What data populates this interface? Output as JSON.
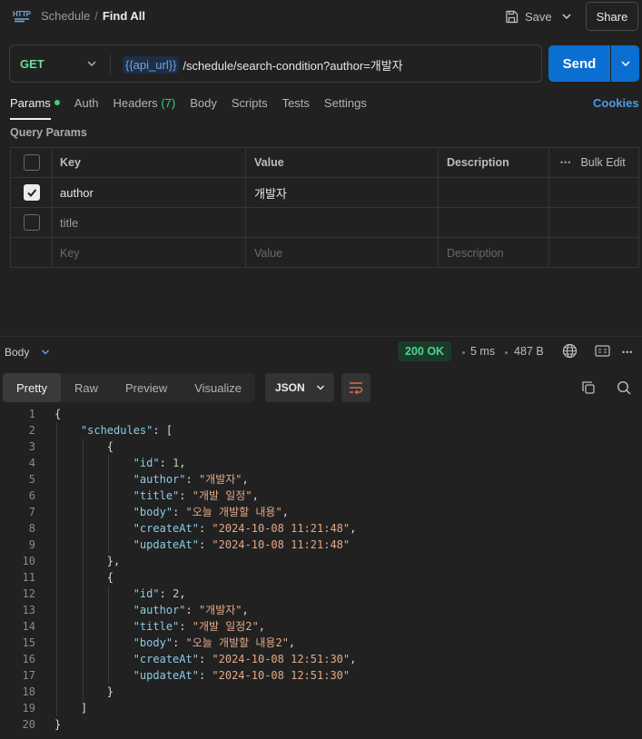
{
  "topbar": {
    "method_badge": "HTTP",
    "collection": "Schedule",
    "separator": "/",
    "request_name": "Find All",
    "save_label": "Save",
    "share_label": "Share"
  },
  "request": {
    "method": "GET",
    "url_variable": "{{api_url}}",
    "url_path": "/schedule/search-condition?author=개발자",
    "send_label": "Send"
  },
  "tabs": {
    "params": "Params",
    "auth": "Auth",
    "headers": "Headers",
    "headers_count": "(7)",
    "body": "Body",
    "scripts": "Scripts",
    "tests": "Tests",
    "settings": "Settings",
    "cookies": "Cookies"
  },
  "query_params": {
    "title": "Query Params",
    "headers": {
      "key": "Key",
      "value": "Value",
      "description": "Description",
      "bulk_edit": "Bulk Edit",
      "more": "•••"
    },
    "rows": [
      {
        "key": "author",
        "value": "개발자",
        "description": "",
        "checked": true
      },
      {
        "key": "title",
        "value": "",
        "description": "",
        "checked": false
      }
    ],
    "placeholders": {
      "key": "Key",
      "value": "Value",
      "description": "Description"
    }
  },
  "response": {
    "section_label": "Body",
    "status": "200 OK",
    "time": "5 ms",
    "size": "487 B",
    "view_tabs": [
      "Pretty",
      "Raw",
      "Preview",
      "Visualize"
    ],
    "active_view": "Pretty",
    "format": "JSON",
    "more": "•••"
  },
  "code_lines": [
    "1",
    "2",
    "3",
    "4",
    "5",
    "6",
    "7",
    "8",
    "9",
    "10",
    "11",
    "12",
    "13",
    "14",
    "15",
    "16",
    "17",
    "18",
    "19",
    "20"
  ],
  "json_body": {
    "schedules_key": "\"schedules\"",
    "items": [
      {
        "id": "1",
        "author": "\"개발자\"",
        "title": "\"개발 일정\"",
        "body": "\"오늘 개발할 내용\"",
        "createAt": "\"2024-10-08 11:21:48\"",
        "updateAt": "\"2024-10-08 11:21:48\""
      },
      {
        "id": "2",
        "author": "\"개발자\"",
        "title": "\"개발 일정2\"",
        "body": "\"오늘 개발할 내용2\"",
        "createAt": "\"2024-10-08 12:51:30\"",
        "updateAt": "\"2024-10-08 12:51:30\""
      }
    ],
    "keys": {
      "id": "\"id\"",
      "author": "\"author\"",
      "title": "\"title\"",
      "body": "\"body\"",
      "createAt": "\"createAt\"",
      "updateAt": "\"updateAt\""
    }
  },
  "colors": {
    "accent": "#0b6fd2",
    "method_get": "#6bdd9a",
    "status_ok": "#4fd48a",
    "link": "#4a9be8",
    "json_key": "#8ccbe6",
    "json_string": "#e3a98a",
    "json_number": "#b7d59b"
  }
}
